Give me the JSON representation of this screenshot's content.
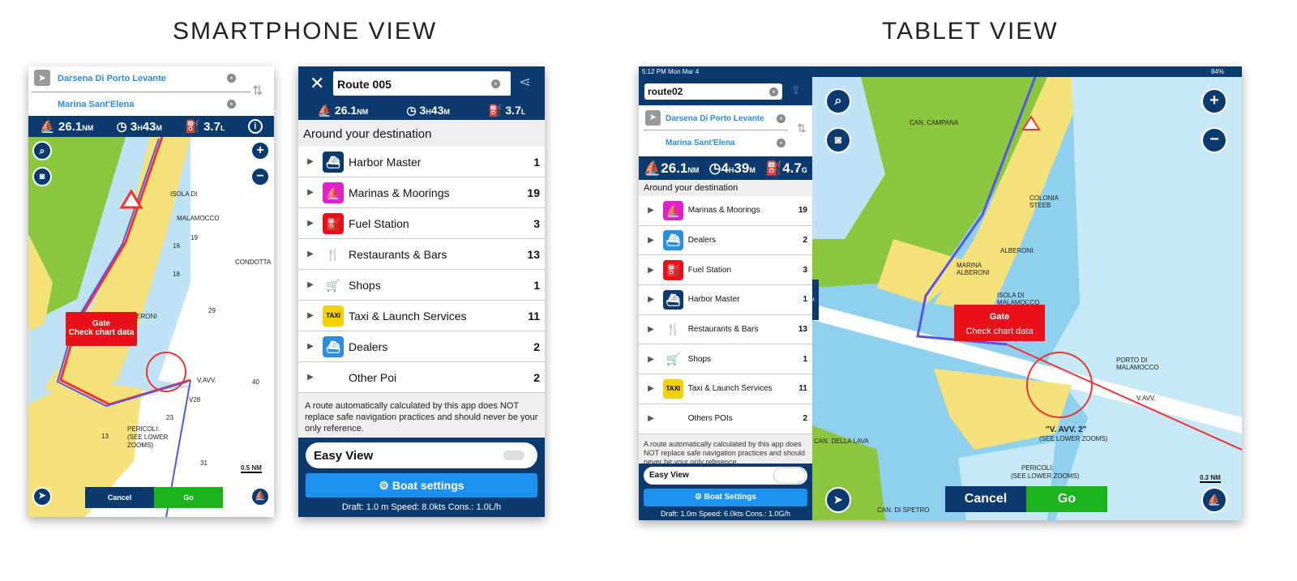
{
  "headings": {
    "smartphone": "SMARTPHONE VIEW",
    "tablet": "TABLET VIEW"
  },
  "phone1": {
    "from": "Darsena Di Porto Levante",
    "to": "Marina Sant'Elena",
    "distance": "26.1",
    "distance_unit": "NM",
    "time_h": "3",
    "time_m": "43",
    "fuel": "3.7",
    "fuel_unit": "L",
    "gate_title": "Gate",
    "gate_text": "Check chart data",
    "cancel": "Cancel",
    "go": "Go",
    "scale": "0.5 NM",
    "map_labels": [
      "ISOLA DI",
      "MALAMOCCO",
      "ALBERONI",
      "CONDOTTA",
      "V.AVV.",
      "V28",
      "PERICOLI:",
      "(SEE LOWER",
      "ZOOMS)",
      "19",
      "16",
      "18",
      "29",
      "40",
      "23",
      "31",
      "13"
    ]
  },
  "phone2": {
    "route_name": "Route 005",
    "distance": "26.1",
    "distance_unit": "NM",
    "time_h": "3",
    "time_m": "43",
    "fuel": "3.7",
    "fuel_unit": "L",
    "section": "Around your destination",
    "items": [
      {
        "label": "Harbor Master",
        "count": "1",
        "icon": "harbor-master-icon"
      },
      {
        "label": "Marinas & Moorings",
        "count": "19",
        "icon": "marina-icon"
      },
      {
        "label": "Fuel Station",
        "count": "3",
        "icon": "fuel-icon"
      },
      {
        "label": "Restaurants & Bars",
        "count": "13",
        "icon": "restaurant-icon"
      },
      {
        "label": "Shops",
        "count": "1",
        "icon": "shop-cart-icon"
      },
      {
        "label": "Taxi & Launch Services",
        "count": "11",
        "icon": "taxi-icon"
      },
      {
        "label": "Dealers",
        "count": "2",
        "icon": "dealer-boat-icon"
      },
      {
        "label": "Other Poi",
        "count": "2",
        "icon": ""
      }
    ],
    "disclaimer": "A route automatically calculated by this app does NOT replace safe navigation practices and should never be your only reference.",
    "easy_view": "Easy View",
    "boat_settings": "Boat settings",
    "boat_info": "Draft: 1.0 m Speed: 8.0kts Cons.: 1.0L/h"
  },
  "tablet": {
    "status_time": "5:12 PM  Mon Mar 4",
    "battery": "84%",
    "route_name": "route02",
    "from": "Darsena Di Porto Levante",
    "to": "Marina Sant'Elena",
    "distance": "26.1",
    "distance_unit": "NM",
    "time_h": "4",
    "time_m": "39",
    "fuel": "4.7",
    "fuel_unit": "G",
    "section": "Around your destination",
    "items": [
      {
        "label": "Marinas & Moorings",
        "count": "19",
        "icon": "marina-icon"
      },
      {
        "label": "Dealers",
        "count": "2",
        "icon": "dealer-boat-icon"
      },
      {
        "label": "Fuel Station",
        "count": "3",
        "icon": "fuel-icon"
      },
      {
        "label": "Harbor Master",
        "count": "1",
        "icon": "harbor-master-icon"
      },
      {
        "label": "Restaurants & Bars",
        "count": "13",
        "icon": "restaurant-icon"
      },
      {
        "label": "Shops",
        "count": "1",
        "icon": "shop-cart-icon"
      },
      {
        "label": "Taxi & Launch Services",
        "count": "11",
        "icon": "taxi-icon"
      },
      {
        "label": "Others POIs",
        "count": "2",
        "icon": ""
      }
    ],
    "disclaimer": "A route automatically calculated by this app does NOT replace safe navigation practices and should never be your only reference.",
    "easy_view": "Easy View",
    "boat_settings": "Boat Settings",
    "boat_info": "Draft: 1.0m Speed: 6.0kts Cons.: 1.0G/h",
    "gate_title": "Gate",
    "gate_text": "Check chart data",
    "cancel": "Cancel",
    "go": "Go",
    "scale": "0.3 NM",
    "map_labels": [
      "CAN. CAMPANA",
      "COLONIA STEEB",
      "MARINA ALBERONI",
      "ISOLA DI MALAMOCCO",
      "ALBERONI",
      "PORTO DI MALAMOCCO",
      "\"V. AVV. 2\"",
      "(SEE LOWER ZOOMS)",
      "PERICOLI:",
      "(SEE LOWER ZOOMS)",
      "CAN. DELLA LAVA",
      "V.AVV.",
      "CAN. DI SPETRO"
    ]
  },
  "colors": {
    "navy": "#0b3a6e",
    "accent": "#1e90ee",
    "go": "#1db31d",
    "gate": "#e8111a",
    "land": "#f5e27a",
    "green": "#8cc63f",
    "water": "#bfe3f4"
  }
}
